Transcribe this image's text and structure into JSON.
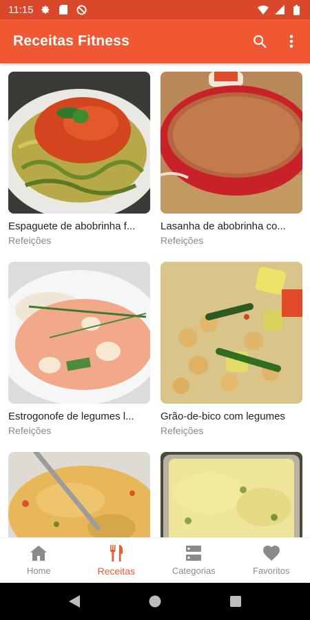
{
  "status_bar": {
    "time": "11:15",
    "icons": [
      "gear-icon",
      "sim-card-icon",
      "no-disturb-icon",
      "wifi-icon",
      "signal-icon",
      "battery-icon"
    ]
  },
  "app_bar": {
    "title": "Receitas Fitness",
    "actions": [
      "search-icon",
      "more-vert-icon"
    ]
  },
  "recipes": [
    {
      "title": "Espaguete de abobrinha f...",
      "category": "Refeições"
    },
    {
      "title": "Lasanha de abobrinha co...",
      "category": "Refeições"
    },
    {
      "title": "Estrogonofe de legumes l...",
      "category": "Refeições"
    },
    {
      "title": "Grão-de-bico com legumes",
      "category": "Refeições"
    },
    {
      "title": "",
      "category": ""
    },
    {
      "title": "",
      "category": ""
    }
  ],
  "bottom_nav": {
    "items": [
      {
        "label": "Home",
        "icon": "home-icon"
      },
      {
        "label": "Receitas",
        "icon": "fork-knife-icon",
        "active": true
      },
      {
        "label": "Categorias",
        "icon": "categories-icon"
      },
      {
        "label": "Favoritos",
        "icon": "heart-icon"
      }
    ]
  },
  "colors": {
    "status_bar": "#d9482b",
    "app_bar": "#ef5833",
    "accent": "#ef5833",
    "inactive": "#8a8a8a"
  }
}
